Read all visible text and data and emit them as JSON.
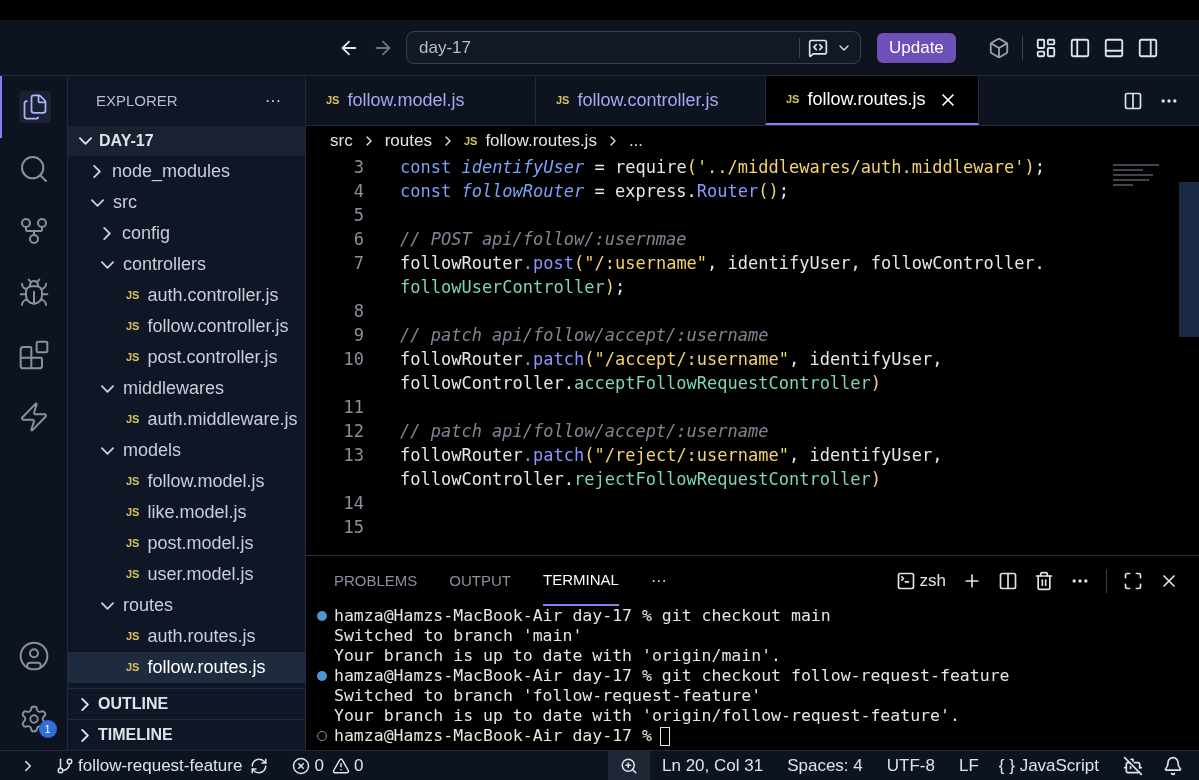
{
  "title_bar": {
    "search": {
      "value": "day-17"
    },
    "forward_disabled": true,
    "update_button": "Update"
  },
  "activity_bar": {
    "items": [
      {
        "kind": "files",
        "selected": true
      },
      {
        "kind": "search",
        "selected": false
      },
      {
        "kind": "source-control",
        "selected": false
      },
      {
        "kind": "debug",
        "selected": false
      },
      {
        "kind": "extensions",
        "selected": false
      },
      {
        "kind": "bolt",
        "selected": false
      }
    ],
    "settings_badge": "1"
  },
  "sidebar": {
    "title": "EXPLORER",
    "more": "···",
    "root": {
      "label": "DAY-17",
      "expanded": true
    },
    "tree": [
      {
        "label": "node_modules",
        "expanded": false
      },
      {
        "label": "src",
        "expanded": true,
        "children": [
          {
            "label": "config",
            "expanded": false
          },
          {
            "label": "controllers",
            "expanded": true,
            "children": [
              {
                "label": "auth.controller.js",
                "badge": "JS",
                "selected": false
              },
              {
                "label": "follow.controller.js",
                "badge": "JS",
                "selected": false
              },
              {
                "label": "post.controller.js",
                "badge": "JS",
                "selected": false
              }
            ]
          },
          {
            "label": "middlewares",
            "expanded": true,
            "children": [
              {
                "label": "auth.middleware.js",
                "badge": "JS",
                "selected": false
              }
            ]
          },
          {
            "label": "models",
            "expanded": true,
            "children": [
              {
                "label": "follow.model.js",
                "badge": "JS",
                "selected": false
              },
              {
                "label": "like.model.js",
                "badge": "JS",
                "selected": false
              },
              {
                "label": "post.model.js",
                "badge": "JS",
                "selected": false
              },
              {
                "label": "user.model.js",
                "badge": "JS",
                "selected": false
              }
            ]
          },
          {
            "label": "routes",
            "expanded": true,
            "children": [
              {
                "label": "auth.routes.js",
                "badge": "JS",
                "selected": false
              },
              {
                "label": "follow.routes.js",
                "badge": "JS",
                "selected": true
              }
            ]
          }
        ]
      }
    ],
    "sections": [
      {
        "label": "OUTLINE",
        "expanded": false
      },
      {
        "label": "TIMELINE",
        "expanded": false
      }
    ]
  },
  "tabs": [
    {
      "badge": "JS",
      "label": "follow.model.js",
      "selected": false
    },
    {
      "badge": "JS",
      "label": "follow.controller.js",
      "selected": false
    },
    {
      "badge": "JS",
      "label": "follow.routes.js",
      "selected": true
    }
  ],
  "breadcrumbs": [
    {
      "label": "src"
    },
    {
      "label": "routes"
    },
    {
      "badge": "JS",
      "label": "follow.routes.js"
    },
    {
      "label": "..."
    }
  ],
  "code": [
    {
      "number": "3",
      "segments": [
        {
          "kind": "keyword",
          "text": "const "
        },
        {
          "kind": "var",
          "text": "identifyUser"
        },
        {
          "kind": "plain",
          "text": " = "
        },
        {
          "kind": "func",
          "text": "require"
        },
        {
          "kind": "paren",
          "text": "("
        },
        {
          "kind": "string",
          "text": "'../middlewares/auth.middleware'"
        },
        {
          "kind": "paren",
          "text": ")"
        },
        {
          "kind": "plain",
          "text": ";"
        }
      ]
    },
    {
      "number": "4",
      "segments": [
        {
          "kind": "keyword",
          "text": "const "
        },
        {
          "kind": "var",
          "text": "followRouter"
        },
        {
          "kind": "plain",
          "text": " = express."
        },
        {
          "kind": "method",
          "text": "Router"
        },
        {
          "kind": "paren",
          "text": "()"
        },
        {
          "kind": "plain",
          "text": ";"
        }
      ]
    },
    {
      "number": "5"
    },
    {
      "number": "6",
      "segments": [
        {
          "kind": "comment",
          "text": "// POST api/follow/:usernmae"
        }
      ]
    },
    {
      "number": "7",
      "segments": [
        {
          "kind": "plain",
          "text": "followRouter"
        },
        {
          "kind": "method",
          "text": ".post"
        },
        {
          "kind": "paren",
          "text": "("
        },
        {
          "kind": "string",
          "text": "\"/:username\""
        },
        {
          "kind": "plain",
          "text": ", identifyUser, followController."
        }
      ]
    },
    {
      "segments": [
        {
          "kind": "prop",
          "text": "followUserController"
        },
        {
          "kind": "paren",
          "text": ")"
        },
        {
          "kind": "plain",
          "text": ";"
        }
      ]
    },
    {
      "number": "8"
    },
    {
      "number": "9",
      "segments": [
        {
          "kind": "comment",
          "text": "// patch api/follow/accept/:username"
        }
      ]
    },
    {
      "number": "10",
      "segments": [
        {
          "kind": "plain",
          "text": "followRouter"
        },
        {
          "kind": "method",
          "text": ".patch"
        },
        {
          "kind": "paren",
          "text": "("
        },
        {
          "kind": "string",
          "text": "\"/accept/:username\""
        },
        {
          "kind": "plain",
          "text": ", identifyUser,"
        }
      ]
    },
    {
      "segments": [
        {
          "kind": "plain",
          "text": "followController."
        },
        {
          "kind": "prop",
          "text": "acceptFollowRequestController"
        },
        {
          "kind": "paren",
          "text": ")"
        }
      ]
    },
    {
      "number": "11"
    },
    {
      "number": "12",
      "segments": [
        {
          "kind": "comment",
          "text": "// patch api/follow/accept/:username"
        }
      ]
    },
    {
      "number": "13",
      "segments": [
        {
          "kind": "plain",
          "text": "followRouter"
        },
        {
          "kind": "method",
          "text": ".patch"
        },
        {
          "kind": "paren",
          "text": "("
        },
        {
          "kind": "string",
          "text": "\"/reject/:username\""
        },
        {
          "kind": "plain",
          "text": ", identifyUser,"
        }
      ]
    },
    {
      "segments": [
        {
          "kind": "plain",
          "text": "followController."
        },
        {
          "kind": "prop",
          "text": "rejectFollowRequestController"
        },
        {
          "kind": "paren",
          "text": ")"
        }
      ]
    },
    {
      "number": "14"
    },
    {
      "number": "15"
    }
  ],
  "panel": {
    "tabs": [
      {
        "label": "PROBLEMS",
        "selected": false
      },
      {
        "label": "OUTPUT",
        "selected": false
      },
      {
        "label": "TERMINAL",
        "selected": true
      }
    ],
    "more": "···",
    "shell": "zsh",
    "terminal": [
      {
        "kind": "command",
        "text": "hamza@Hamzs-MacBook-Air day-17 % git checkout main"
      },
      {
        "kind": "output",
        "text": "Switched to branch 'main'"
      },
      {
        "kind": "output",
        "text": "Your branch is up to date with 'origin/main'."
      },
      {
        "kind": "command",
        "text": "hamza@Hamzs-MacBook-Air day-17 % git checkout follow-request-feature"
      },
      {
        "kind": "output",
        "text": "Switched to branch 'follow-request-feature'"
      },
      {
        "kind": "output",
        "text": "Your branch is up to date with 'origin/follow-request-feature'."
      },
      {
        "kind": "prompt",
        "text": "hamza@Hamzs-MacBook-Air day-17 %",
        "cursor": true
      }
    ]
  },
  "status_bar": {
    "branch": "follow-request-feature",
    "errors": "0",
    "warnings": "0",
    "position": "Ln 20, Col 31",
    "spaces": "Spaces: 4",
    "encoding": "UTF-8",
    "eol": "LF",
    "language_icon": "{ }",
    "language": "JavaScript"
  }
}
